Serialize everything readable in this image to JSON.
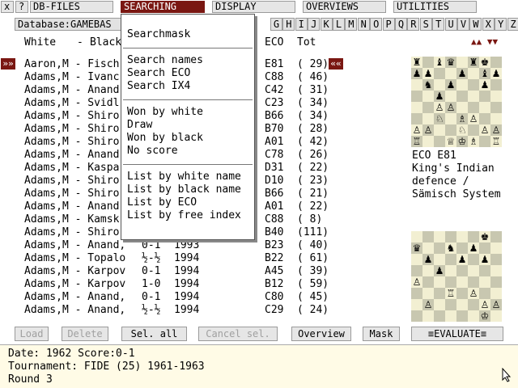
{
  "menu": {
    "close_label": "x",
    "help_label": "?",
    "items": [
      "DB-FILES",
      "SEARCHING",
      "DISPLAY",
      "OVERVIEWS",
      "UTILITIES"
    ]
  },
  "database_label": "Database:GAMEBAS",
  "letters": [
    "G",
    "H",
    "I",
    "J",
    "K",
    "L",
    "M",
    "N",
    "O",
    "P",
    "Q",
    "R",
    "S",
    "T",
    "U",
    "V",
    "W",
    "X",
    "Y",
    "Z"
  ],
  "columns": {
    "white": "White",
    "dash": "-",
    "black": "Black",
    "eco": "ECO",
    "tot": "Tot",
    "sort": "▲▲ ▼▼"
  },
  "row_pointer_left": "»»",
  "row_pointer_right": "««",
  "rows": [
    {
      "name": "Aaron,M - Fisch",
      "result": "",
      "year": "",
      "eco": "E81",
      "tot": "( 29)"
    },
    {
      "name": "Adams,M - Ivanc",
      "result": "",
      "year": "",
      "eco": "C88",
      "tot": "( 46)"
    },
    {
      "name": "Adams,M - Anand",
      "result": "",
      "year": "",
      "eco": "C42",
      "tot": "( 31)"
    },
    {
      "name": "Adams,M - Svidl",
      "result": "",
      "year": "",
      "eco": "C23",
      "tot": "( 34)"
    },
    {
      "name": "Adams,M - Shiro",
      "result": "",
      "year": "",
      "eco": "B66",
      "tot": "( 34)"
    },
    {
      "name": "Adams,M - Shiro",
      "result": "",
      "year": "",
      "eco": "B70",
      "tot": "( 28)"
    },
    {
      "name": "Adams,M - Shiro",
      "result": "",
      "year": "",
      "eco": "A01",
      "tot": "( 42)"
    },
    {
      "name": "Adams,M - Anand",
      "result": "",
      "year": "",
      "eco": "C78",
      "tot": "( 26)"
    },
    {
      "name": "Adams,M - Kaspa",
      "result": "",
      "year": "",
      "eco": "D31",
      "tot": "( 22)"
    },
    {
      "name": "Adams,M - Shiro",
      "result": "",
      "year": "",
      "eco": "D10",
      "tot": "( 23)"
    },
    {
      "name": "Adams,M - Shiro",
      "result": "",
      "year": "",
      "eco": "B66",
      "tot": "( 21)"
    },
    {
      "name": "Adams,M - Anand",
      "result": "",
      "year": "",
      "eco": "A01",
      "tot": "( 22)"
    },
    {
      "name": "Adams,M - Kamsk",
      "result": "",
      "year": "",
      "eco": "C88",
      "tot": "(  8)"
    },
    {
      "name": "Adams,M - Shiro",
      "result": "",
      "year": "",
      "eco": "B40",
      "tot": "(111)"
    },
    {
      "name": "Adams,M - Anand,",
      "result": "0-1",
      "year": "1993",
      "eco": "B23",
      "tot": "( 40)"
    },
    {
      "name": "Adams,M - Topalo",
      "result": "½-½",
      "year": "1994",
      "eco": "B22",
      "tot": "( 61)"
    },
    {
      "name": "Adams,M - Karpov",
      "result": "0-1",
      "year": "1994",
      "eco": "A45",
      "tot": "( 39)"
    },
    {
      "name": "Adams,M - Karpov",
      "result": "1-0",
      "year": "1994",
      "eco": "B12",
      "tot": "( 59)"
    },
    {
      "name": "Adams,M - Anand,",
      "result": "0-1",
      "year": "1994",
      "eco": "C80",
      "tot": "( 45)"
    },
    {
      "name": "Adams,M - Anand,",
      "result": "½-½",
      "year": "1994",
      "eco": "C29",
      "tot": "( 24)"
    }
  ],
  "dropdown": {
    "groups": [
      [
        "Searchmask"
      ],
      [
        "Search names",
        "Search ECO",
        "Search IX4"
      ],
      [
        "Won by white",
        "Draw",
        "Won by black",
        "No score"
      ],
      [
        "List by white name",
        "List by black name",
        "List by ECO",
        "List by free index"
      ]
    ]
  },
  "eco_info": {
    "code": "ECO E81",
    "line1": "King's Indian",
    "line2": "defence /",
    "line3": "Sämisch System"
  },
  "board1": [
    "r.bq.rk.",
    "pp..p.bp",
    ".n.p..p.",
    "..p.....",
    "..PP....",
    "..N.BP..",
    "PP..N.PP",
    "R..QKB.R"
  ],
  "board2": [
    "......k.",
    "q..n.p..",
    ".p..p.p.",
    "..p.....",
    "P.......",
    "...R.P..",
    ".P....PP",
    "......K."
  ],
  "buttons": [
    {
      "label": "Load",
      "enabled": false
    },
    {
      "label": "Delete",
      "enabled": false
    },
    {
      "label": "Sel. all",
      "enabled": true
    },
    {
      "label": "Cancel sel.",
      "enabled": false
    },
    {
      "label": "Overview",
      "enabled": true
    },
    {
      "label": "Mask",
      "enabled": true
    },
    {
      "label": "≡EVALUATE≡",
      "enabled": true
    }
  ],
  "info": {
    "line1": "Date: 1962  Score:0-1",
    "line2": "Tournament: FIDE (25) 1961-1963",
    "line3": "Round 3"
  },
  "colors": {
    "accent": "#7a1712",
    "light_square": "#f2efd2",
    "dark_square": "#c8c7b0",
    "info_bg": "#fffbe6",
    "disabled_text": "#a0a0a0"
  }
}
